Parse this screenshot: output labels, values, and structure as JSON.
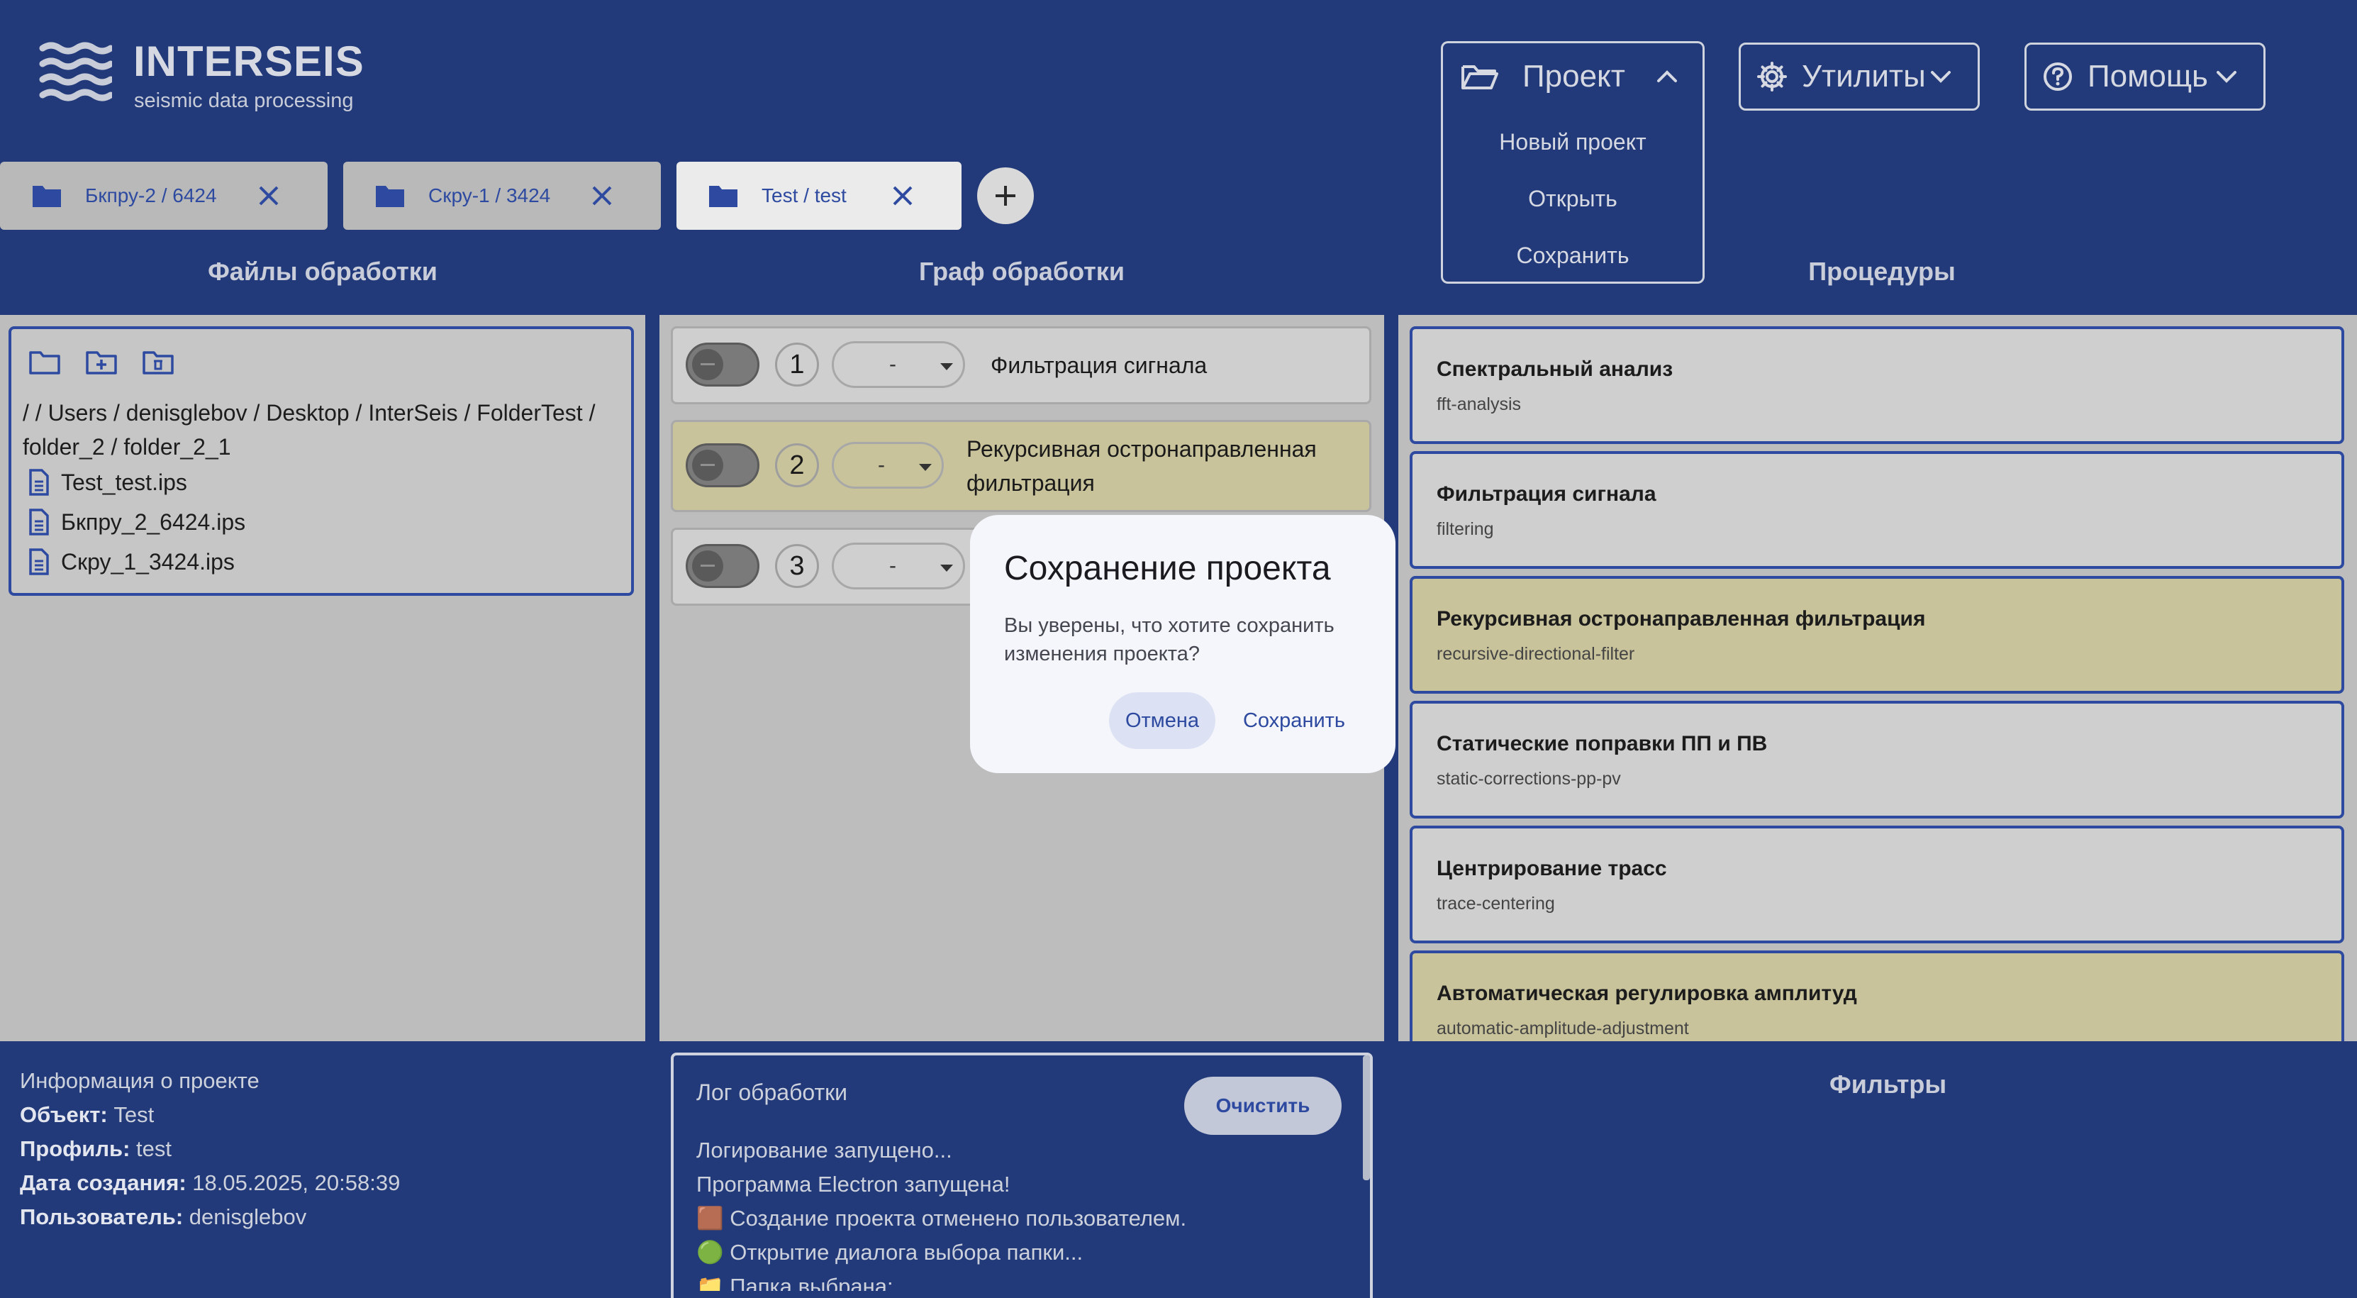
{
  "app": {
    "logo_title": "INTERSEIS",
    "logo_subtitle": "seismic data processing"
  },
  "menu": {
    "project": {
      "label": "Проект",
      "items": [
        "Новый проект",
        "Открыть",
        "Сохранить"
      ]
    },
    "utils": {
      "label": "Утилиты"
    },
    "help": {
      "label": "Помощь"
    }
  },
  "tabs": [
    {
      "label": "Бкпру-2 / 6424"
    },
    {
      "label": "Скру-1 / 3424"
    },
    {
      "label": "Test / test"
    }
  ],
  "sections": {
    "files": "Файлы обработки",
    "graph": "Граф обработки",
    "procedures": "Процедуры",
    "filters": "Фильтры"
  },
  "files": {
    "path": "/ / Users / denisglebov / Desktop / InterSeis / FolderTest / folder_2 / folder_2_1",
    "items": [
      "Test_test.ips",
      "Бкпру_2_6424.ips",
      "Скру_1_3424.ips"
    ]
  },
  "graph": [
    {
      "num": "1",
      "select": "-",
      "title": "Фильтрация сигнала"
    },
    {
      "num": "2",
      "select": "-",
      "title": "Рекурсивная остронаправленная фильтрация"
    },
    {
      "num": "3",
      "select": "-",
      "title": ""
    }
  ],
  "procedures": [
    {
      "title": "Спектральный анализ",
      "id": "fft-analysis",
      "highlighted": false
    },
    {
      "title": "Фильтрация сигнала",
      "id": "filtering",
      "highlighted": false
    },
    {
      "title": "Рекурсивная остронаправленная фильтрация",
      "id": "recursive-directional-filter",
      "highlighted": true
    },
    {
      "title": "Статические поправки ПП и ПВ",
      "id": "static-corrections-pp-pv",
      "highlighted": false
    },
    {
      "title": "Центрирование трасс",
      "id": "trace-centering",
      "highlighted": false
    },
    {
      "title": "Автоматическая регулировка амплитуд",
      "id": "automatic-amplitude-adjustment",
      "highlighted": true
    }
  ],
  "info": {
    "heading": "Информация о проекте",
    "object_label": "Объект:",
    "object": "Test",
    "profile_label": "Профиль:",
    "profile": "test",
    "created_label": "Дата создания:",
    "created": "18.05.2025, 20:58:39",
    "user_label": "Пользователь:",
    "user": "denisglebov"
  },
  "log": {
    "title": "Лог обработки",
    "clear": "Очистить",
    "lines": [
      "Логирование запущено...",
      "Программа Electron запущена!",
      "🟫 Создание проекта отменено пользователем.",
      "🟢 Открытие диалога выбора папки...",
      "📁 Папка выбрана:"
    ]
  },
  "dialog": {
    "title": "Сохранение проекта",
    "text": "Вы уверены, что хотите сохранить изменения проекта?",
    "cancel": "Отмена",
    "confirm": "Сохранить"
  },
  "colors": {
    "background": "#223a7a",
    "accent": "#2d4aa0",
    "highlight": "#c9c39b"
  }
}
